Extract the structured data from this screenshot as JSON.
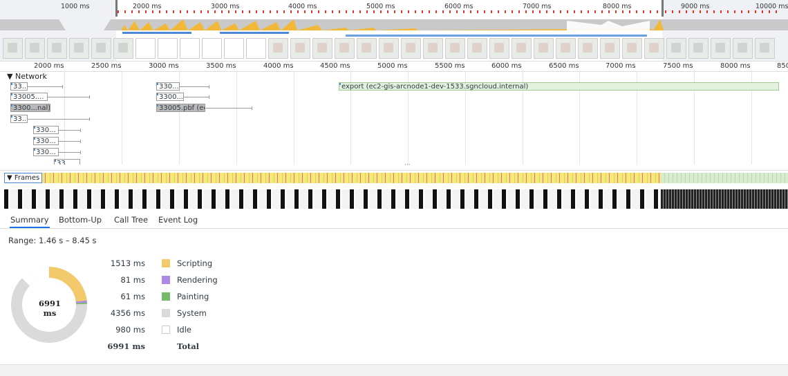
{
  "overview": {
    "ticks": [
      "1000 ms",
      "2000 ms",
      "3000 ms",
      "4000 ms",
      "5000 ms",
      "6000 ms",
      "7000 ms",
      "8000 ms",
      "9000 ms",
      "10000 ms"
    ]
  },
  "ruler": {
    "ticks": [
      "2000 ms",
      "2500 ms",
      "3000 ms",
      "3500 ms",
      "4000 ms",
      "4500 ms",
      "5000 ms",
      "5500 ms",
      "6000 ms",
      "6500 ms",
      "7000 ms",
      "7500 ms",
      "8000 ms",
      "850"
    ]
  },
  "network": {
    "title": "Network",
    "requests": [
      "33...",
      "33005....",
      "3300...nal)",
      "33...",
      "330...",
      "330...",
      "330...",
      "33",
      "330...",
      "3300...",
      "33005.pbf (ec2-g...",
      "export (ec2-gis-arcnode1-dev-1533.sgncloud.internal)"
    ]
  },
  "frames": {
    "title": "Frames"
  },
  "tabs": [
    "Summary",
    "Bottom-Up",
    "Call Tree",
    "Event Log"
  ],
  "summary": {
    "range": "Range: 1.46 s – 8.45 s",
    "total_center": "6991 ms",
    "rows": [
      {
        "value": "1513 ms",
        "name": "Scripting",
        "color": "#f2c96b"
      },
      {
        "value": "81 ms",
        "name": "Rendering",
        "color": "#a98be3"
      },
      {
        "value": "61 ms",
        "name": "Painting",
        "color": "#7ab86c"
      },
      {
        "value": "4356 ms",
        "name": "System",
        "color": "#dadada"
      },
      {
        "value": "980 ms",
        "name": "Idle",
        "color": "#ffffff"
      }
    ],
    "total": {
      "value": "6991 ms",
      "name": "Total"
    }
  }
}
